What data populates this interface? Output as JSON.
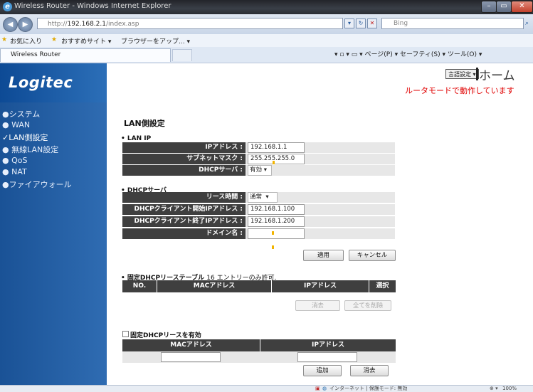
{
  "window": {
    "title": "Wireless Router - Windows Internet Explorer"
  },
  "browser": {
    "url_prefix": "http://",
    "url_host": "192.168.2.1",
    "url_path": "/index.asp",
    "search_placeholder": "Bing",
    "favorites_label": "お気に入り",
    "recommended_sites": "おすすめサイト ▾",
    "browser_upgrade": "ブラウザーをアップ... ▾",
    "tab_title": "Wireless Router",
    "command_bar": "▾ ▫ ▾ ▭ ▾ ページ(P) ▾ セーフティ(S) ▾ ツール(O) ▾",
    "status_text": "インターネット | 保護モード: 無効",
    "zoom": "100%"
  },
  "header": {
    "logo": "Logitec",
    "language_button": "言語設定 ▾",
    "home": "ホーム",
    "mode_text": "ルータモードで動作しています"
  },
  "sidebar": {
    "items": [
      {
        "label": "●システム"
      },
      {
        "label": "● WAN"
      },
      {
        "label": "✓LAN側設定"
      },
      {
        "label": "● 無線LAN設定"
      },
      {
        "label": "● QoS"
      },
      {
        "label": "● NAT"
      },
      {
        "label": "●ファイアウォール"
      }
    ]
  },
  "main": {
    "title": "LAN側設定",
    "lan_ip": {
      "heading": "• LAN IP",
      "ip_label": "IPアドレス :",
      "ip_value": "192.168.1.1",
      "subnet_label": "サブネットマスク :",
      "subnet_value": "255.255.255.0",
      "dhcp_label": "DHCPサーバ :",
      "dhcp_value": "有効"
    },
    "dhcp": {
      "heading": "• DHCPサーバ",
      "lease_label": "リース時間 :",
      "lease_value": "通常",
      "start_label": "DHCPクライアント開始IPアドレス :",
      "start_value": "192.168.1.100",
      "end_label": "DHCPクライアント終了IPアドレス :",
      "end_value": "192.168.1.200",
      "domain_label": "ドメイン名 :",
      "domain_value": ""
    },
    "apply_button": "適用",
    "cancel_button": "キャンセル",
    "static_table": {
      "heading": "• 固定DHCPリーステーブル",
      "note": "16 エントリーのみ許可.",
      "col_no": "NO.",
      "col_mac": "MACアドレス",
      "col_ip": "IPアドレス",
      "col_select": "選択",
      "delete_button": "消去",
      "delete_all_button": "全てを削除"
    },
    "static_enable": {
      "checkbox_label": "固定DHCPリースを有効",
      "col_mac": "MACアドレス",
      "col_ip": "IPアドレス",
      "add_button": "追加",
      "clear_button": "消去"
    }
  }
}
